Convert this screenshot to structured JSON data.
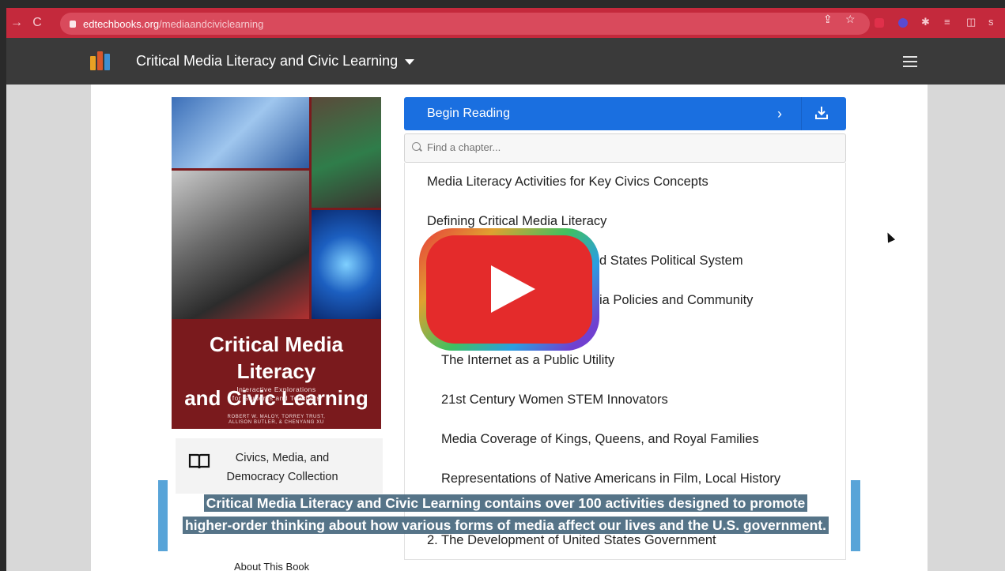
{
  "browser": {
    "url_host": "edtechbooks.org",
    "url_path": "/mediaandciviclearning"
  },
  "navbar": {
    "title": "Critical Media Literacy and Civic Learning"
  },
  "book": {
    "cover_title_line1": "Critical Media Literacy",
    "cover_title_line2": "and Civic Learning",
    "cover_subtitle_line1": "Interactive Explorations",
    "cover_subtitle_line2": "for Students and Teachers",
    "cover_authors_line1": "ROBERT W. MALOY, TORREY TRUST,",
    "cover_authors_line2": "ALLISON BUTLER, & CHENYANG XU",
    "collection_line1": "Civics, Media, and",
    "collection_line2": "Democracy Collection",
    "about_label": "About This Book"
  },
  "reader": {
    "begin_label": "Begin Reading",
    "search_placeholder": "Find a chapter...",
    "chapters": [
      "Media Literacy Activities for Key Civics Concepts",
      "Defining Critical Media Literacy",
      "d States Political System",
      "ia Policies and Community",
      "The Internet as a Public Utility",
      "21st Century Women STEM Innovators",
      "Media Coverage of Kings, Queens, and Royal Families",
      "Representations of Native Americans in Film, Local History",
      "2. The Development of United States Government"
    ]
  },
  "caption": {
    "line1": "Critical Media Literacy and Civic Learning contains over 100 activities designed to promote",
    "line2": "higher-order thinking about how various forms of media affect our lives and the U.S. government."
  },
  "colors": {
    "chrome": "#c4293c",
    "navbar": "#3a3a3a",
    "accent_blue": "#1a6fe0",
    "cover_red": "#7a1a1d",
    "play_red": "#e42b2b",
    "caption_bar": "#58a4d8"
  }
}
